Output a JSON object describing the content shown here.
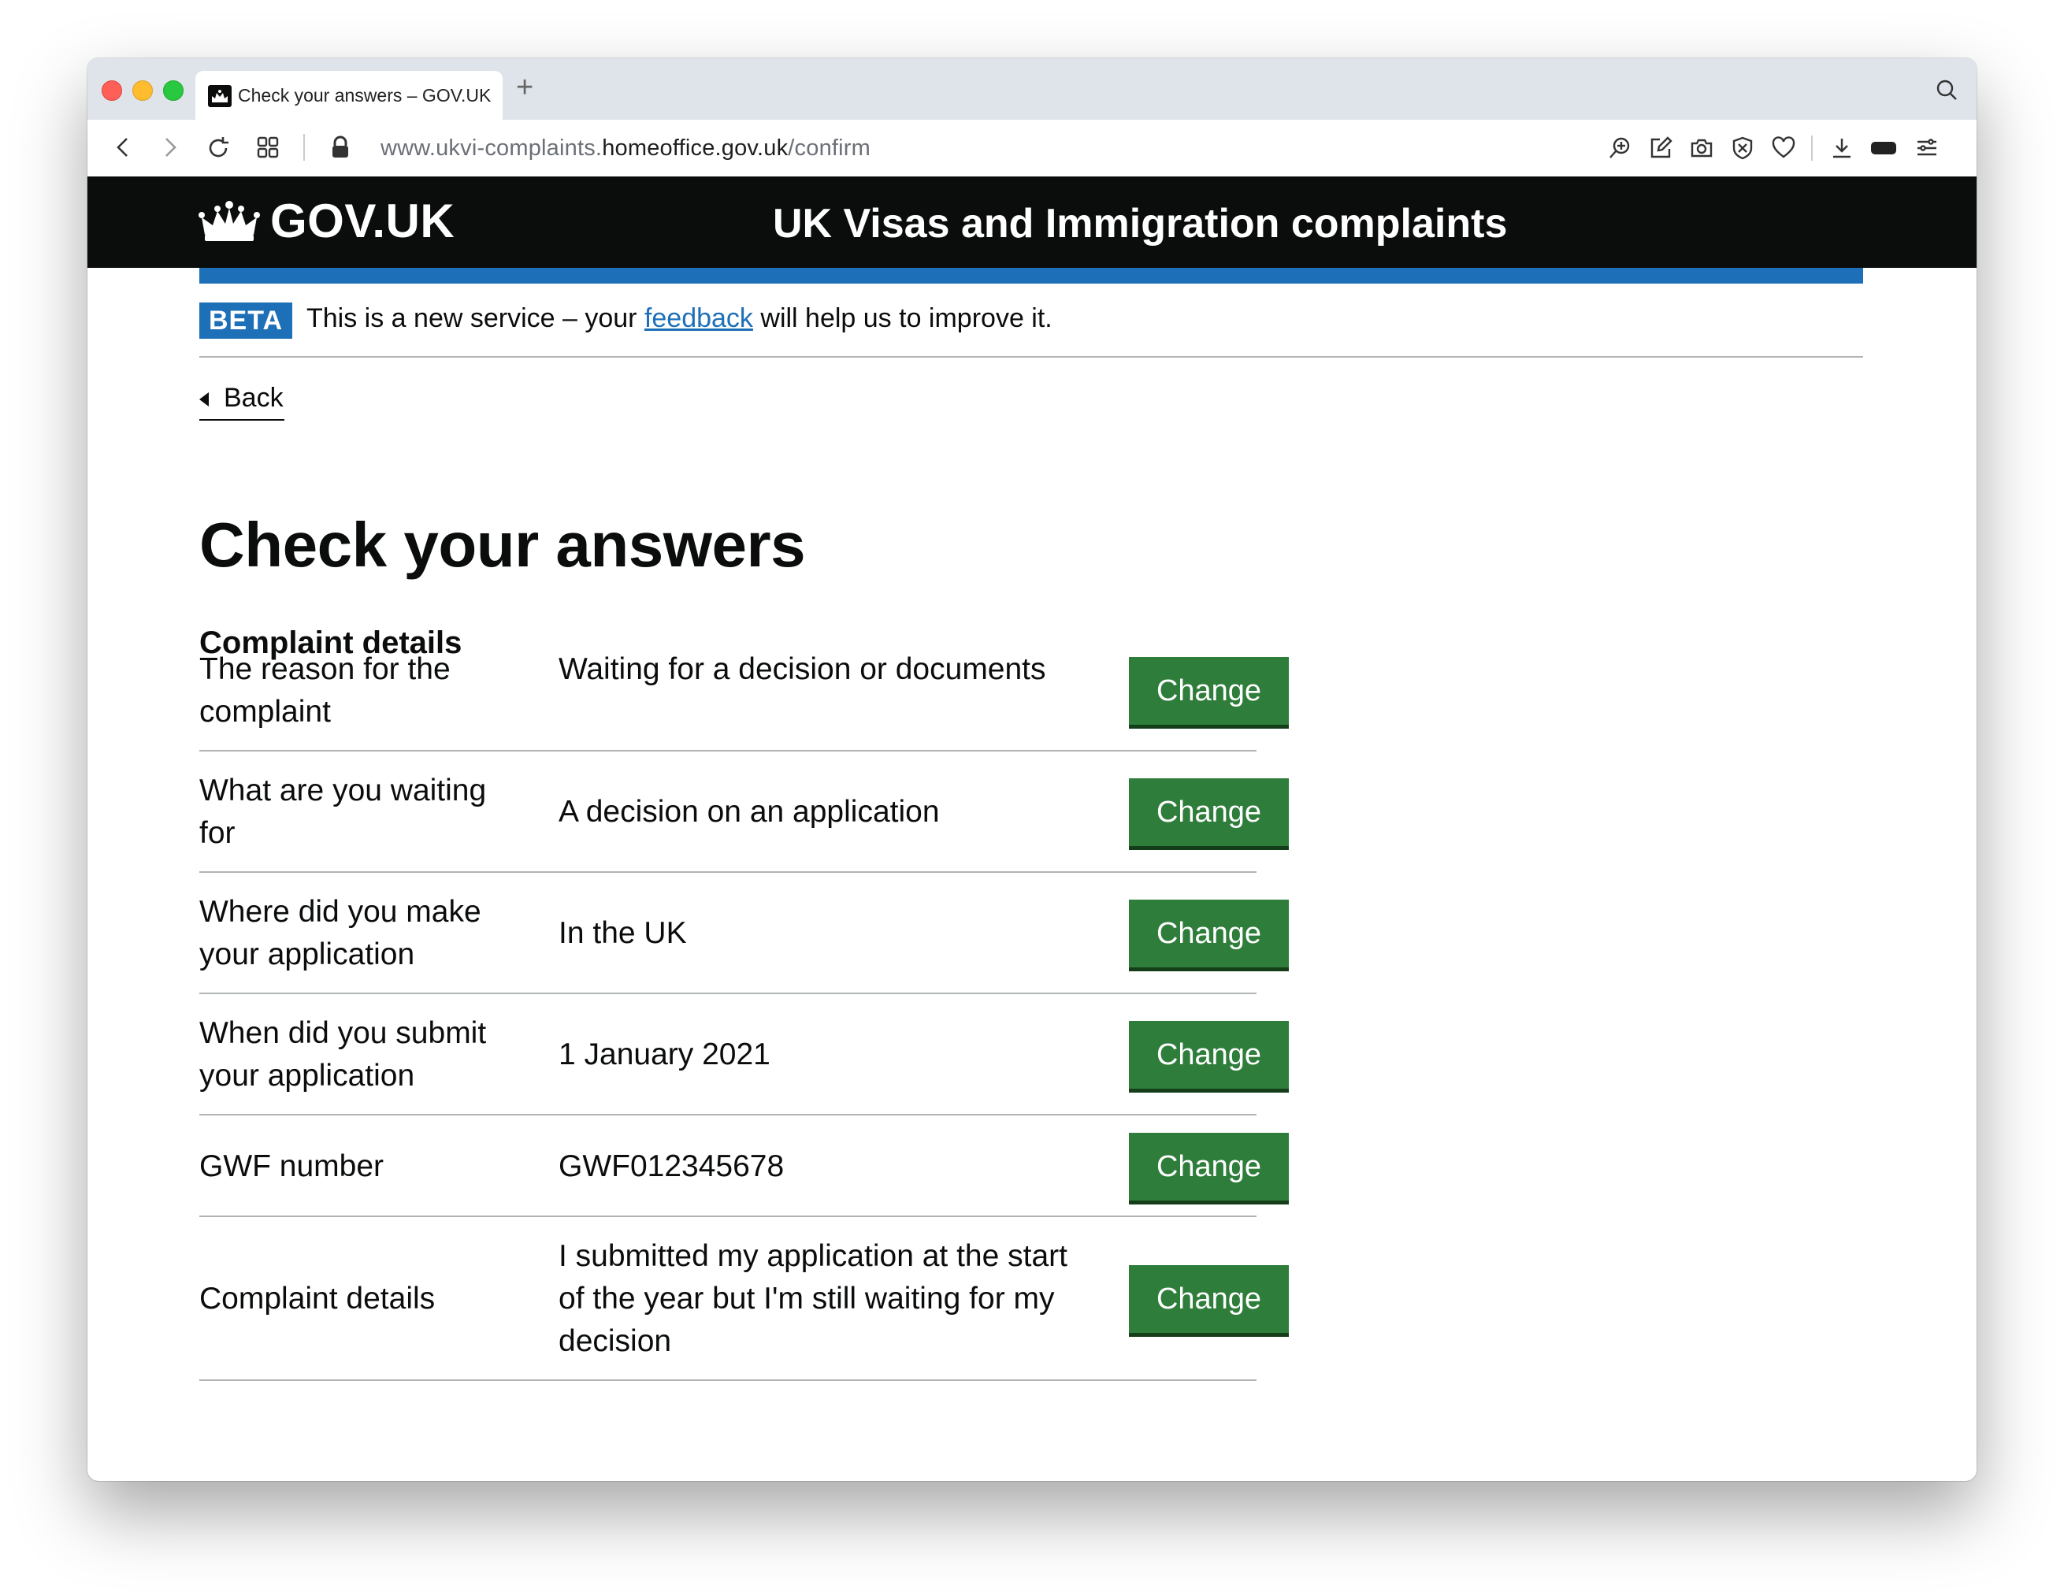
{
  "browser": {
    "tab_title": "Check your answers – GOV.UK",
    "new_tab": "+",
    "url_prefix": "www.ukvi-complaints.",
    "url_host": "homeoffice.gov.uk",
    "url_path": "/confirm",
    "nav_icons": [
      "back-arrow-icon",
      "forward-arrow-icon",
      "reload-icon",
      "tab-grid-icon",
      "lock-icon"
    ],
    "toolbar_icons": [
      "zoom-icon",
      "edit-icon",
      "camera-icon",
      "shield-icon",
      "heart-icon",
      "download-icon",
      "battery-icon",
      "menu-icon"
    ]
  },
  "header": {
    "logo_text": "GOV.UK",
    "service_name": "UK Visas and Immigration complaints"
  },
  "phase_banner": {
    "tag": "BETA",
    "text_before": "This is a new service – your ",
    "link": "feedback",
    "text_after": " will help us to improve it."
  },
  "back_link": "Back",
  "page_title": "Check your answers",
  "section_heading": "Complaint details",
  "summary_rows": [
    {
      "key": "The reason for the complaint",
      "value": "Waiting for a decision or documents",
      "action": "Change"
    },
    {
      "key": "What are you waiting for",
      "value": "A decision on an application",
      "action": "Change"
    },
    {
      "key": "Where did you make your application",
      "value": "In the UK",
      "action": "Change"
    },
    {
      "key": "When did you submit your application",
      "value": "1 January 2021",
      "action": "Change"
    },
    {
      "key": "GWF number",
      "value": "GWF012345678",
      "action": "Change"
    },
    {
      "key": "Complaint details",
      "value": "I submitted my application at the start of the year but I'm still waiting for my decision",
      "action": "Change"
    }
  ],
  "colors": {
    "header_bg": "#0b0c0c",
    "brand_blue": "#1d70b8",
    "button_green": "#2f7d3b",
    "link": "#1d70b8"
  }
}
